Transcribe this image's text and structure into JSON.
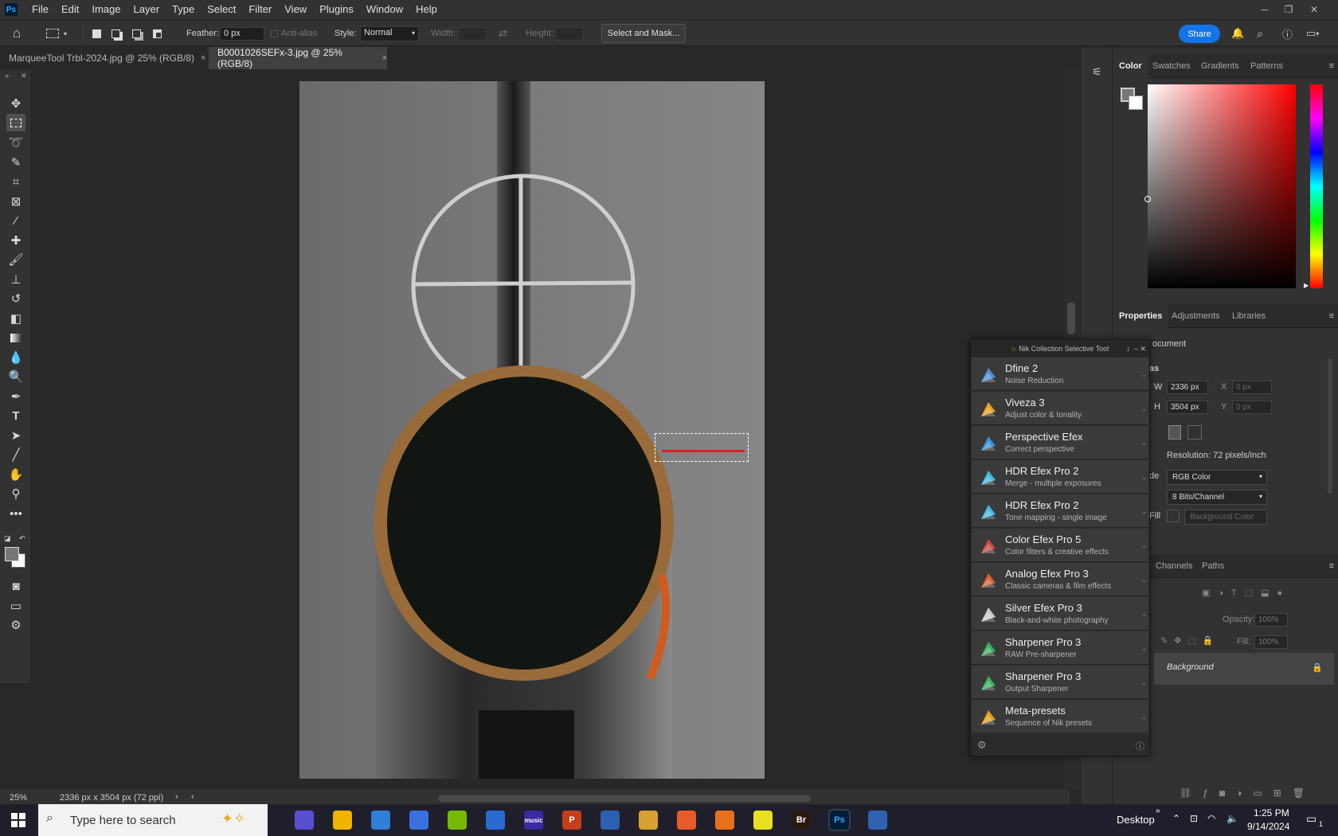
{
  "app": {
    "logo": "Ps"
  },
  "menu": [
    "File",
    "Edit",
    "Image",
    "Layer",
    "Type",
    "Select",
    "Filter",
    "View",
    "Plugins",
    "Window",
    "Help"
  ],
  "options": {
    "feather_label": "Feather:",
    "feather_value": "0 px",
    "antialias_label": "Anti-alias",
    "style_label": "Style:",
    "style_value": "Normal",
    "width_label": "Width:",
    "height_label": "Height:",
    "select_mask": "Select and Mask...",
    "share": "Share"
  },
  "tabs": [
    {
      "label": "MarqueeTool Trbl-2024.jpg @ 25% (RGB/8)",
      "close": "×"
    },
    {
      "label": "B0001026SEFx-3.jpg @ 25% (RGB/8)",
      "close": "×"
    }
  ],
  "status": {
    "zoom": "25%",
    "doc_info": "2336 px x 3504 px (72 ppi)"
  },
  "color_panel": {
    "tabs": [
      "Color",
      "Swatches",
      "Gradients",
      "Patterns"
    ]
  },
  "properties_panel": {
    "tabs": [
      "Properties",
      "Adjustments",
      "Libraries"
    ],
    "doc_label": "ocument",
    "canvas_label": "as",
    "w_label": "W",
    "w_value": "2336 px",
    "h_label": "H",
    "h_value": "3504 px",
    "x_label": "X",
    "x_value": "0 px",
    "y_label": "Y",
    "y_value": "0 px",
    "resolution": "Resolution: 72 pixels/inch",
    "mode_label": "de",
    "mode_value": "RGB Color",
    "depth_value": "8 Bits/Channel",
    "fill_label": "Fill",
    "fill_value": "Background Color"
  },
  "layers_panel": {
    "tabs": [
      "Channels",
      "Paths"
    ],
    "opacity_label": "Opacity:",
    "opacity_value": "100%",
    "fill_label": "Fill:",
    "fill_value": "100%",
    "layer_name": "Background"
  },
  "nik": {
    "title": "Nik Collection Selective Tool",
    "items": [
      {
        "name": "Dfine 2",
        "desc": "Noise Reduction",
        "color": "#4a8fd8"
      },
      {
        "name": "Viveza 3",
        "desc": "Adjust color & tonality",
        "color": "#e8a020"
      },
      {
        "name": "Perspective Efex",
        "desc": "Correct perspective",
        "color": "#3a90d8"
      },
      {
        "name": "HDR Efex Pro 2",
        "desc": "Merge - multiple exposures",
        "color": "#40b8e0"
      },
      {
        "name": "HDR Efex Pro 2",
        "desc": "Tone mapping - single image",
        "color": "#40b8e0"
      },
      {
        "name": "Color Efex Pro 5",
        "desc": "Color filters & creative effects",
        "color": "#d04848"
      },
      {
        "name": "Analog Efex Pro 3",
        "desc": "Classic cameras & film effects",
        "color": "#d86030"
      },
      {
        "name": "Silver Efex Pro 3",
        "desc": "Black-and-white photography",
        "color": "#c8c8c8"
      },
      {
        "name": "Sharpener Pro 3",
        "desc": "RAW Pre-sharpener",
        "color": "#38b060"
      },
      {
        "name": "Sharpener Pro 3",
        "desc": "Output Sharpener",
        "color": "#38b060"
      },
      {
        "name": "Meta-presets",
        "desc": "Sequence of Nik presets",
        "color": "#e0a020"
      }
    ]
  },
  "taskbar": {
    "search_placeholder": "Type here to search",
    "desktop": "Desktop",
    "time": "1:25 PM",
    "date": "9/14/2024",
    "notif_count": "1",
    "apps": [
      {
        "label": "",
        "color": "#5a4fcf"
      },
      {
        "label": "",
        "color": "#f0b400"
      },
      {
        "label": "",
        "color": "#2f7ed8"
      },
      {
        "label": "",
        "color": "#3a6fe0"
      },
      {
        "label": "",
        "color": "#76b900"
      },
      {
        "label": "",
        "color": "#2a6bd1"
      },
      {
        "label": "music",
        "color": "#3a2aa0"
      },
      {
        "label": "P",
        "color": "#c43e1c"
      },
      {
        "label": "",
        "color": "#2f5fb0"
      },
      {
        "label": "",
        "color": "#d8a030"
      },
      {
        "label": "",
        "color": "#e85a2a"
      },
      {
        "label": "",
        "color": "#e8701a"
      },
      {
        "label": "",
        "color": "#e8e020"
      },
      {
        "label": "Br",
        "color": "#2a1a10"
      },
      {
        "label": "Ps",
        "color": "#001e36"
      },
      {
        "label": "",
        "color": "#3060b0"
      }
    ]
  }
}
